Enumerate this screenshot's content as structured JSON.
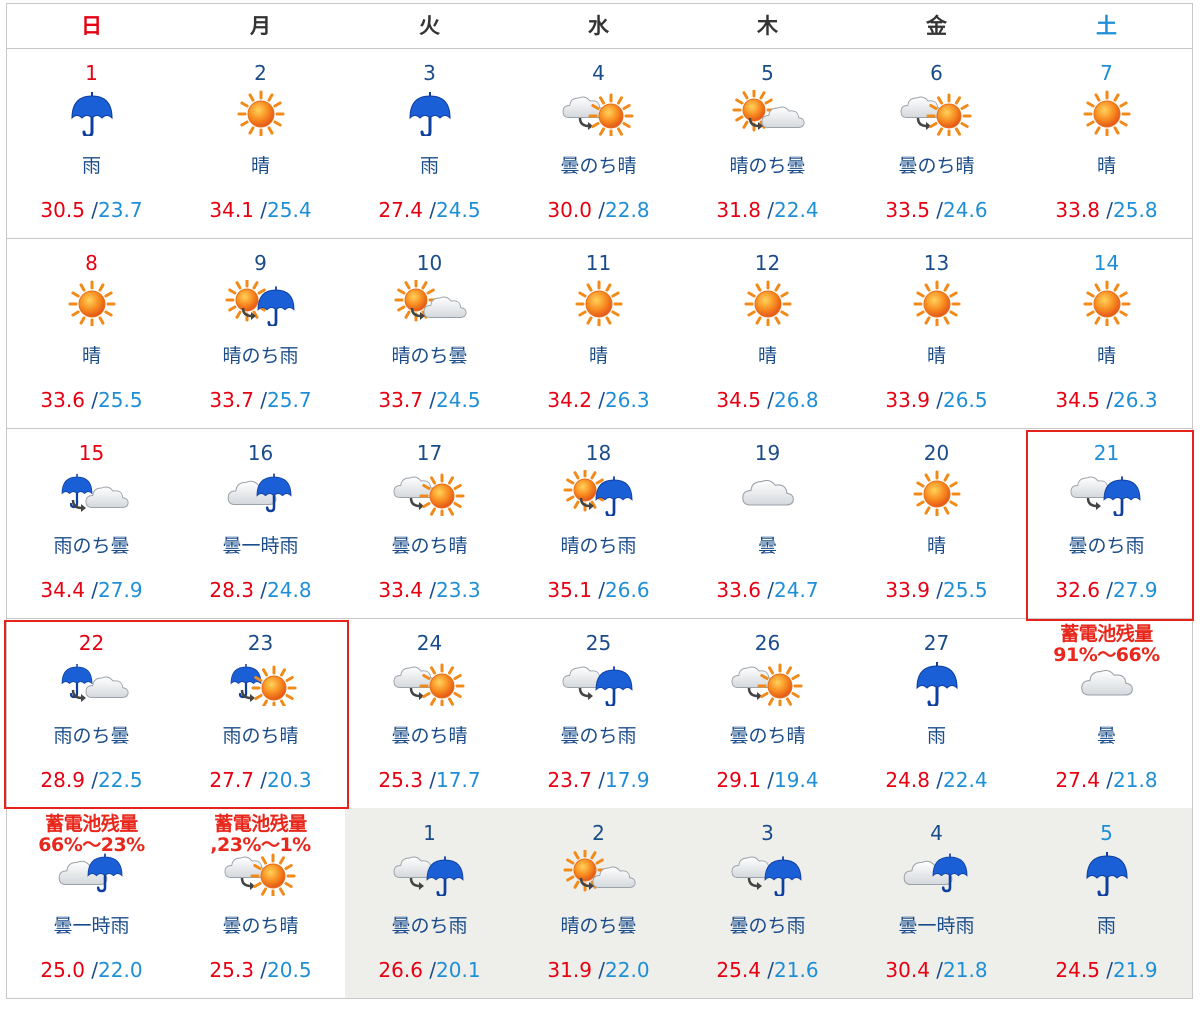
{
  "weekdays": [
    "日",
    "月",
    "火",
    "水",
    "木",
    "金",
    "土"
  ],
  "colors": {
    "sunday": "#e60012",
    "saturday": "#1e8fd6",
    "high": "#e60012",
    "low": "#1e8fd6",
    "highlight": "#e5231b",
    "battery_note": "#e8281c"
  },
  "weeks": [
    [
      {
        "day": "1",
        "icon": "rain-icon",
        "weather": "雨",
        "high": "30.5",
        "low": "23.7"
      },
      {
        "day": "2",
        "icon": "sun-icon",
        "weather": "晴",
        "high": "34.1",
        "low": "25.4"
      },
      {
        "day": "3",
        "icon": "rain-icon",
        "weather": "雨",
        "high": "27.4",
        "low": "24.5"
      },
      {
        "day": "4",
        "icon": "cloud-then-sun-icon",
        "weather": "曇のち晴",
        "high": "30.0",
        "low": "22.8"
      },
      {
        "day": "5",
        "icon": "sun-then-cloud-icon",
        "weather": "晴のち曇",
        "high": "31.8",
        "low": "22.4"
      },
      {
        "day": "6",
        "icon": "cloud-then-sun-icon",
        "weather": "曇のち晴",
        "high": "33.5",
        "low": "24.6"
      },
      {
        "day": "7",
        "icon": "sun-icon",
        "weather": "晴",
        "high": "33.8",
        "low": "25.8"
      }
    ],
    [
      {
        "day": "8",
        "icon": "sun-icon",
        "weather": "晴",
        "high": "33.6",
        "low": "25.5"
      },
      {
        "day": "9",
        "icon": "sun-then-rain-icon",
        "weather": "晴のち雨",
        "high": "33.7",
        "low": "25.7"
      },
      {
        "day": "10",
        "icon": "sun-then-cloud-icon",
        "weather": "晴のち曇",
        "high": "33.7",
        "low": "24.5"
      },
      {
        "day": "11",
        "icon": "sun-icon",
        "weather": "晴",
        "high": "34.2",
        "low": "26.3"
      },
      {
        "day": "12",
        "icon": "sun-icon",
        "weather": "晴",
        "high": "34.5",
        "low": "26.8"
      },
      {
        "day": "13",
        "icon": "sun-icon",
        "weather": "晴",
        "high": "33.9",
        "low": "26.5"
      },
      {
        "day": "14",
        "icon": "sun-icon",
        "weather": "晴",
        "high": "34.5",
        "low": "26.3"
      }
    ],
    [
      {
        "day": "15",
        "icon": "rain-then-cloud-icon",
        "weather": "雨のち曇",
        "high": "34.4",
        "low": "27.9"
      },
      {
        "day": "16",
        "icon": "cloud-sometimes-rain-icon",
        "weather": "曇一時雨",
        "high": "28.3",
        "low": "24.8"
      },
      {
        "day": "17",
        "icon": "cloud-then-sun-icon",
        "weather": "曇のち晴",
        "high": "33.4",
        "low": "23.3"
      },
      {
        "day": "18",
        "icon": "sun-then-rain-icon",
        "weather": "晴のち雨",
        "high": "35.1",
        "low": "26.6"
      },
      {
        "day": "19",
        "icon": "cloud-icon",
        "weather": "曇",
        "high": "33.6",
        "low": "24.7"
      },
      {
        "day": "20",
        "icon": "sun-icon",
        "weather": "晴",
        "high": "33.9",
        "low": "25.5"
      },
      {
        "day": "21",
        "icon": "cloud-then-rain-icon",
        "weather": "曇のち雨",
        "high": "32.6",
        "low": "27.9"
      }
    ],
    [
      {
        "day": "22",
        "icon": "rain-then-cloud-icon",
        "weather": "雨のち曇",
        "high": "28.9",
        "low": "22.5"
      },
      {
        "day": "23",
        "icon": "rain-then-sun-icon",
        "weather": "雨のち晴",
        "high": "27.7",
        "low": "20.3"
      },
      {
        "day": "24",
        "icon": "cloud-then-sun-icon",
        "weather": "曇のち晴",
        "high": "25.3",
        "low": "17.7"
      },
      {
        "day": "25",
        "icon": "cloud-then-rain-icon",
        "weather": "曇のち雨",
        "high": "23.7",
        "low": "17.9"
      },
      {
        "day": "26",
        "icon": "cloud-then-sun-icon",
        "weather": "曇のち晴",
        "high": "29.1",
        "low": "19.4"
      },
      {
        "day": "27",
        "icon": "rain-icon",
        "weather": "雨",
        "high": "24.8",
        "low": "22.4"
      },
      {
        "day": "",
        "note1": "蓄電池残量",
        "note2": "91%～66%",
        "icon": "cloud-icon",
        "weather": "曇",
        "high": "27.4",
        "low": "21.8"
      }
    ],
    [
      {
        "day": "",
        "note1": "蓄電池残量",
        "note2": "66%～23%",
        "icon": "cloud-sometimes-rain-icon",
        "weather": "曇一時雨",
        "high": "25.0",
        "low": "22.0"
      },
      {
        "day": "",
        "note1": "蓄電池残量",
        "note2": ",23%～1%",
        "icon": "cloud-then-sun-icon",
        "weather": "曇のち晴",
        "high": "25.3",
        "low": "20.5"
      },
      {
        "day": "1",
        "icon": "cloud-then-rain-icon",
        "weather": "曇のち雨",
        "high": "26.6",
        "low": "20.1"
      },
      {
        "day": "2",
        "icon": "sun-then-cloud-icon",
        "weather": "晴のち曇",
        "high": "31.9",
        "low": "22.0"
      },
      {
        "day": "3",
        "icon": "cloud-then-rain-icon",
        "weather": "曇のち雨",
        "high": "25.4",
        "low": "21.6"
      },
      {
        "day": "4",
        "icon": "cloud-sometimes-rain-icon",
        "weather": "曇一時雨",
        "high": "30.4",
        "low": "21.8"
      },
      {
        "day": "5",
        "icon": "rain-icon",
        "weather": "雨",
        "high": "24.5",
        "low": "21.9"
      }
    ]
  ]
}
